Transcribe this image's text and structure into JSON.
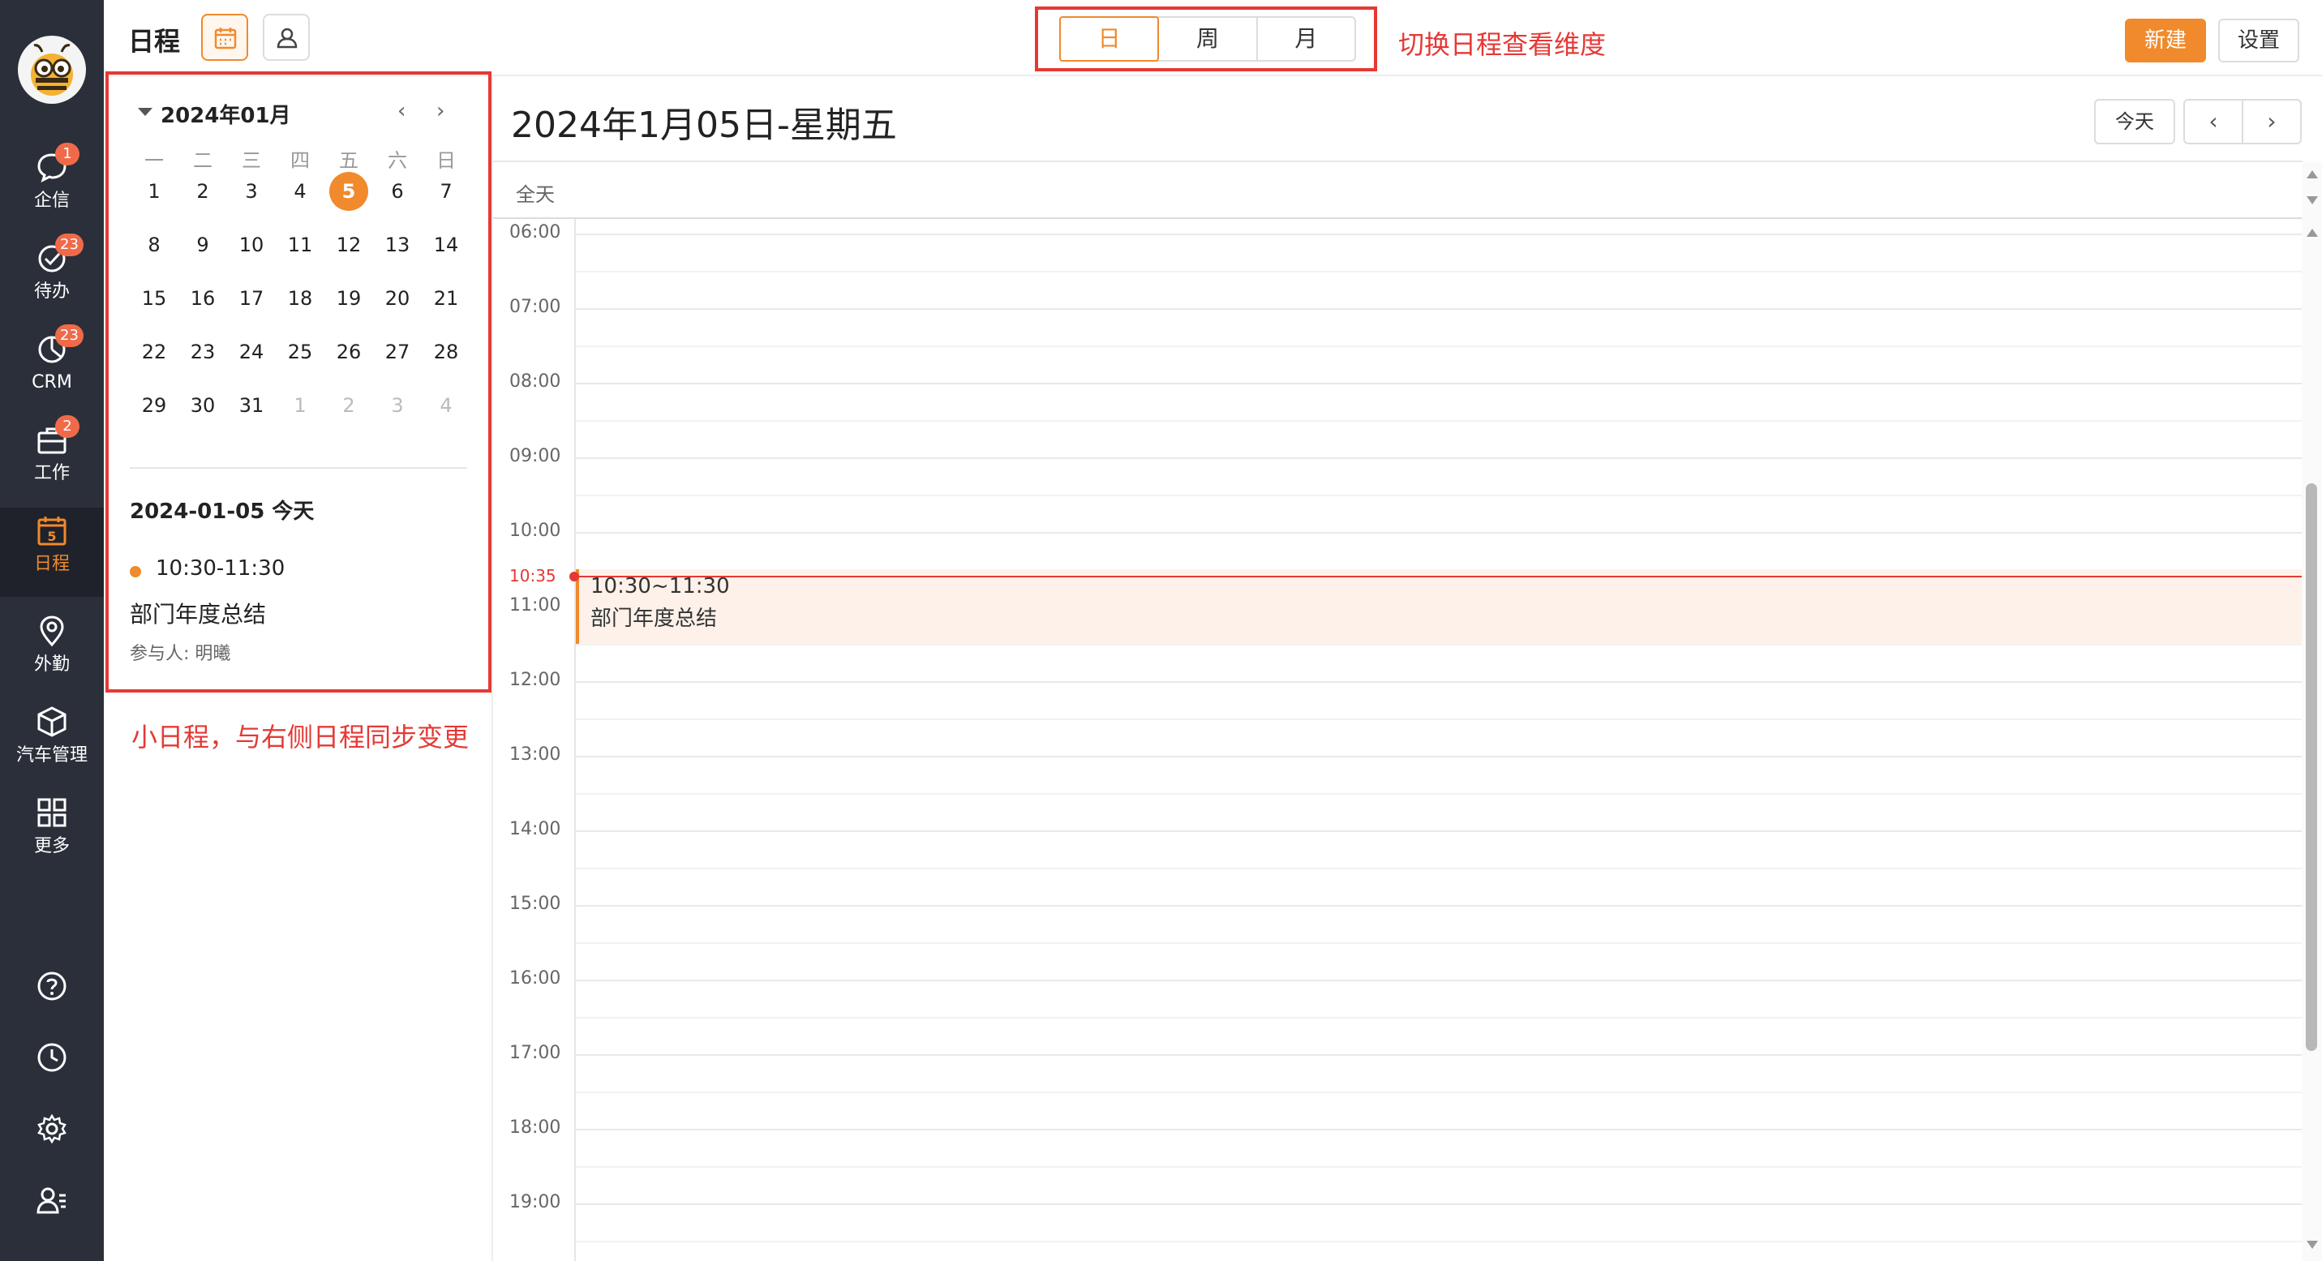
{
  "app": {
    "page_title": "日程"
  },
  "nav": {
    "items": [
      {
        "label": "企信",
        "icon": "chat-bubble-icon",
        "badge": "1"
      },
      {
        "label": "待办",
        "icon": "check-circle-icon",
        "badge": "23"
      },
      {
        "label": "CRM",
        "icon": "pie-chart-icon",
        "badge": "23"
      },
      {
        "label": "工作",
        "icon": "briefcase-icon",
        "badge": "2"
      },
      {
        "label": "日程",
        "icon": "calendar-day-icon",
        "badge": "",
        "day": "5"
      },
      {
        "label": "外勤",
        "icon": "location-pin-icon",
        "badge": ""
      },
      {
        "label": "汽车管理",
        "icon": "cube-icon",
        "badge": ""
      },
      {
        "label": "更多",
        "icon": "grid-icon",
        "badge": ""
      }
    ],
    "bottom": [
      "help-icon",
      "clock-icon",
      "settings-icon",
      "user-list-icon"
    ]
  },
  "toolbar": {
    "view_tabs": [
      "日",
      "周",
      "月"
    ],
    "active_tab": "日",
    "annotation_switch": "切换日程查看维度",
    "new_label": "新建",
    "settings_label": "设置"
  },
  "mini_calendar": {
    "month_label": "2024年01月",
    "weekdays": [
      "一",
      "二",
      "三",
      "四",
      "五",
      "六",
      "日"
    ],
    "weeks": [
      [
        "1",
        "2",
        "3",
        "4",
        "5",
        "6",
        "7"
      ],
      [
        "8",
        "9",
        "10",
        "11",
        "12",
        "13",
        "14"
      ],
      [
        "15",
        "16",
        "17",
        "18",
        "19",
        "20",
        "21"
      ],
      [
        "22",
        "23",
        "24",
        "25",
        "26",
        "27",
        "28"
      ],
      [
        "29",
        "30",
        "31",
        "1",
        "2",
        "3",
        "4"
      ]
    ],
    "today": "5",
    "annotation": "小日程，与右侧日程同步变更"
  },
  "day_events": {
    "date_label": "2024-01-05 今天",
    "items": [
      {
        "time": "10:30-11:30",
        "title": "部门年度总结",
        "participants_label": "参与人:",
        "participants": "明曦"
      }
    ]
  },
  "day_view": {
    "title": "2024年1月05日-星期五",
    "today_button": "今天",
    "prev": "‹",
    "next": "›",
    "allday_label": "全天",
    "hours": [
      "06:00",
      "07:00",
      "08:00",
      "09:00",
      "10:00",
      "11:00",
      "12:00",
      "13:00",
      "14:00",
      "15:00",
      "16:00",
      "17:00",
      "18:00",
      "19:00"
    ],
    "now_label": "10:35",
    "event": {
      "time": "10:30~11:30",
      "title": "部门年度总结"
    }
  },
  "colors": {
    "accent": "#f08a2c",
    "annotation_red": "#e53935",
    "nav_bg": "#2b2f3a"
  }
}
